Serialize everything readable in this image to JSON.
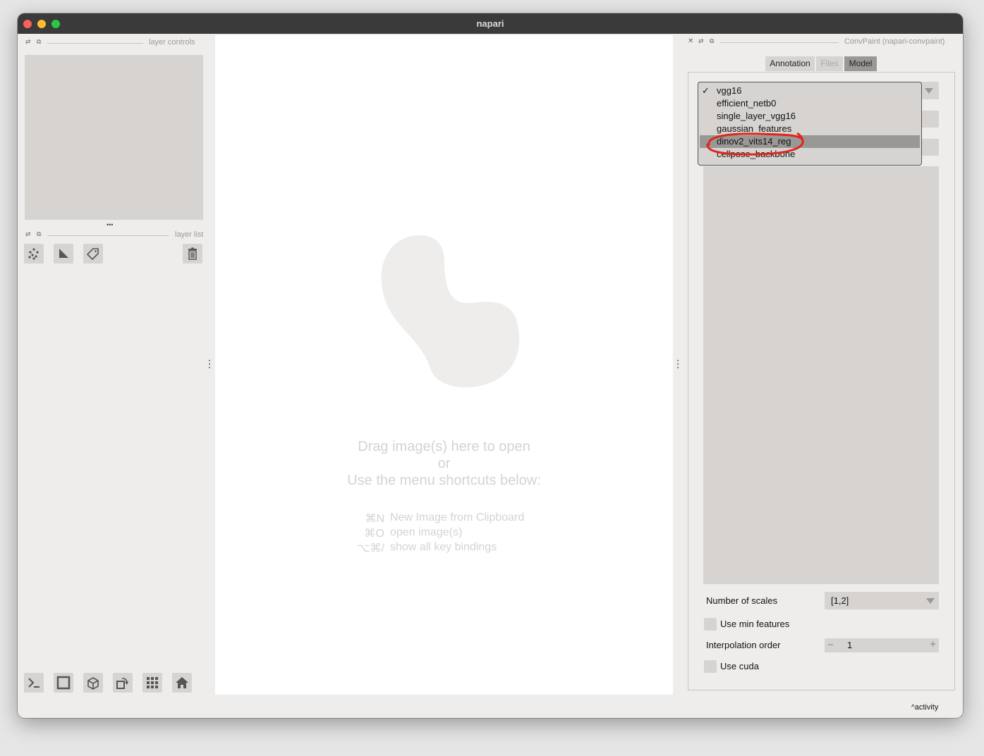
{
  "window": {
    "title": "napari"
  },
  "left_dock": {
    "layer_controls_title": "layer controls",
    "layer_list_title": "layer list",
    "ellipsis": "•••"
  },
  "layer_buttons": [
    "points-icon",
    "shapes-icon",
    "labels-icon"
  ],
  "delete_icon": "trash-icon",
  "bottom_buttons": [
    "console-icon",
    "ndisplay-square-icon",
    "3d-cube-icon",
    "roll-icon",
    "grid-icon",
    "home-icon"
  ],
  "welcome": {
    "line1": "Drag image(s) here to open",
    "line2": "or",
    "line3": "Use the menu shortcuts below:",
    "shortcuts": [
      {
        "key": "⌘N",
        "text": "New Image from Clipboard"
      },
      {
        "key": "⌘O",
        "text": "open image(s)"
      },
      {
        "key": "⌥⌘/",
        "text": "show all key bindings"
      }
    ]
  },
  "plugin": {
    "title": "ConvPaint (napari-convpaint)",
    "tabs": [
      {
        "label": "Annotation",
        "state": "normal"
      },
      {
        "label": "Files",
        "state": "disabled"
      },
      {
        "label": "Model",
        "state": "active"
      }
    ],
    "model_dropdown": {
      "checked_index": 0,
      "highlighted_index": 4,
      "options": [
        "vgg16",
        "efficient_netb0",
        "single_layer_vgg16",
        "gaussian_features",
        "dinov2_vits14_reg",
        "cellpose_backbone"
      ],
      "check_mark": "✓",
      "annotation_color": "#e0261b"
    },
    "number_of_scales": {
      "label": "Number of scales",
      "value": "[1,2]"
    },
    "use_min_features": {
      "label": "Use min features",
      "checked": false
    },
    "interpolation_order": {
      "label": "Interpolation order",
      "value": "1",
      "minus": "−",
      "plus": "+"
    },
    "use_cuda": {
      "label": "Use cuda",
      "checked": false
    }
  },
  "status": {
    "activity": "activity"
  }
}
